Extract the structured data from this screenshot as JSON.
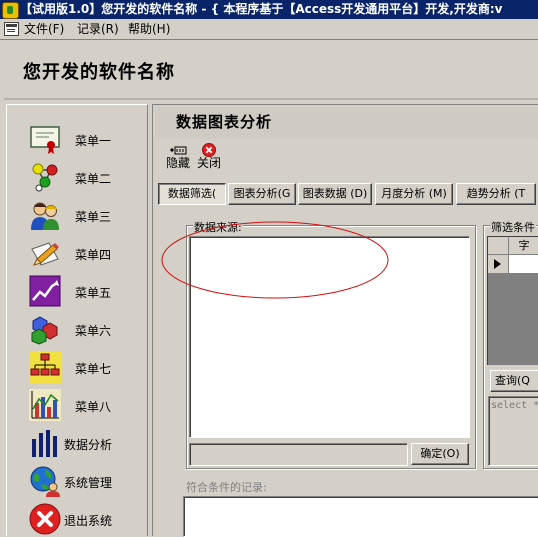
{
  "window": {
    "title": "【试用版1.0】您开发的软件名称 - { 本程序基于【Access开发通用平台】开发,开发商:v"
  },
  "menu": [
    "文件(F)",
    "记录(R)",
    "帮助(H)"
  ],
  "header": {
    "app_name": "您开发的软件名称"
  },
  "sidebar": {
    "items": [
      {
        "label": "菜单一",
        "icon": "certificate-icon"
      },
      {
        "label": "菜单二",
        "icon": "molecule-icon"
      },
      {
        "label": "菜单三",
        "icon": "people-icon"
      },
      {
        "label": "菜单四",
        "icon": "pencil-icon"
      },
      {
        "label": "菜单五",
        "icon": "trend-chart-icon"
      },
      {
        "label": "菜单六",
        "icon": "cubes-icon"
      },
      {
        "label": "菜单七",
        "icon": "org-chart-icon"
      },
      {
        "label": "菜单八",
        "icon": "bar-chart-icon"
      },
      {
        "label": "数据分析",
        "icon": "stats-bars-icon"
      },
      {
        "label": "系统管理",
        "icon": "globe-user-icon"
      },
      {
        "label": "退出系统",
        "icon": "exit-icon"
      }
    ]
  },
  "form": {
    "title": "数据图表分析",
    "toolbar": {
      "hide_label": "隐藏",
      "close_label": "关闭"
    },
    "tabs": [
      {
        "label": "数据筛选(",
        "active": true
      },
      {
        "label": "图表分析(G",
        "active": false
      },
      {
        "label": "图表数据 (D)",
        "active": false
      },
      {
        "label": "月度分析 (M)",
        "active": false
      },
      {
        "label": "趋势分析 (T",
        "active": false
      }
    ],
    "data_source_label": "数据来源:",
    "confirm_button": "确定(O)",
    "filter_label": "筛选条件",
    "filter_column_header": "字",
    "query_button": "查询(Q",
    "sql_text": "select *",
    "matched_records_label": "符合条件的记录:"
  }
}
